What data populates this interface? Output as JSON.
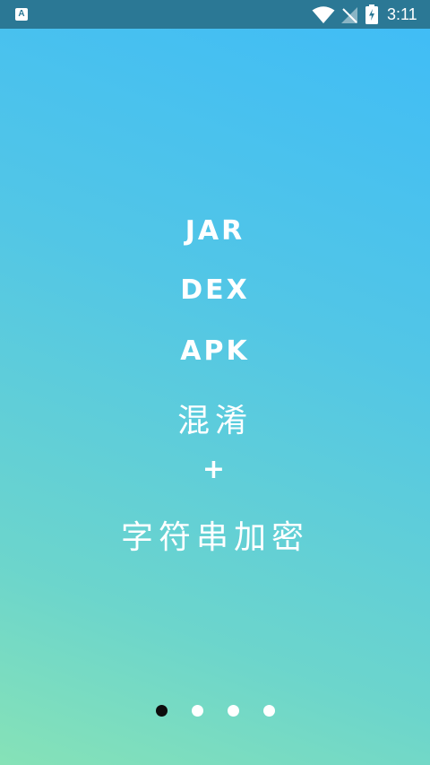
{
  "status_bar": {
    "app_icon_label": "A",
    "time": "3:11",
    "icons": [
      "app-notification-icon",
      "wifi-icon",
      "no-signal-icon",
      "battery-charging-icon"
    ]
  },
  "slide": {
    "lines": [
      "JAR",
      "DEX",
      "APK",
      "混淆",
      "+",
      "字符串加密"
    ]
  },
  "pager": {
    "count": 4,
    "active_index": 0
  },
  "colors": {
    "status_bar_bg": "#2b7895",
    "gradient_top": "#3fbcf7",
    "gradient_bottom": "#86e2b7",
    "text": "#ffffff",
    "dot_active": "#0d0d0d",
    "dot_inactive": "#ffffff"
  }
}
